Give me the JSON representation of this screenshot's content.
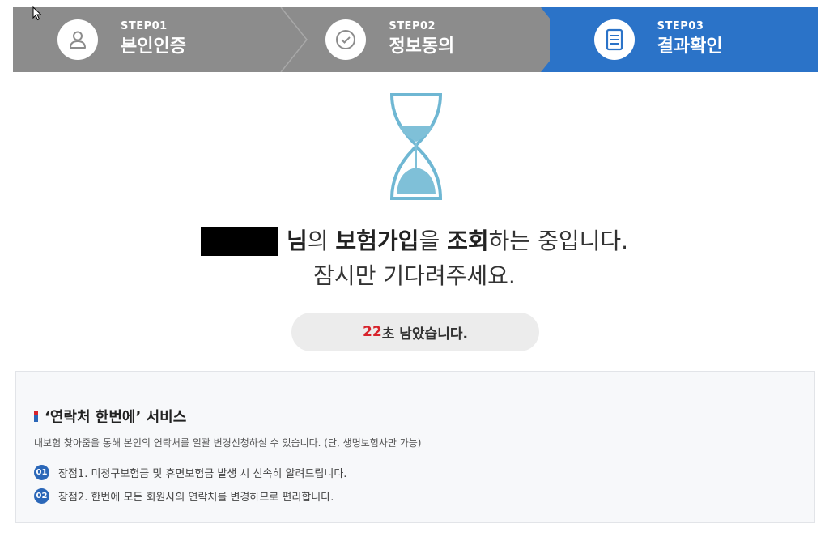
{
  "steps": [
    {
      "num": "STEP01",
      "title": "본인인증",
      "icon": "user-icon",
      "active": false
    },
    {
      "num": "STEP02",
      "title": "정보동의",
      "icon": "check-circle-icon",
      "active": false
    },
    {
      "num": "STEP03",
      "title": "결과확인",
      "icon": "document-icon",
      "active": true
    }
  ],
  "colors": {
    "step_inactive": "#8c8c8c",
    "step_active": "#2b73c8",
    "accent_red": "#d8242c",
    "badge_blue": "#2b67b8",
    "hourglass": "#6fb7d3"
  },
  "message": {
    "suffix_bold_1": "님",
    "text_1": "의 ",
    "bold_2": "보험가입",
    "text_2": "을 ",
    "bold_3": "조회",
    "text_3": "하는 중입니다.",
    "line2": "잠시만 기다려주세요."
  },
  "timer": {
    "seconds": "22",
    "text": "초 남았습니다."
  },
  "service": {
    "title": "‘연락처 한번에’ 서비스",
    "desc": "내보험 찾아줌을 통해 본인의 연락처를 일괄 변경신청하실 수 있습니다. (단, 생명보험사만 가능)",
    "merits": [
      {
        "badge": "01",
        "text": "장점1. 미청구보험금 및 휴면보험금 발생 시 신속히 알려드립니다."
      },
      {
        "badge": "02",
        "text": "장점2. 한번에 모든 회원사의 연락처를 변경하므로 편리합니다."
      }
    ]
  }
}
